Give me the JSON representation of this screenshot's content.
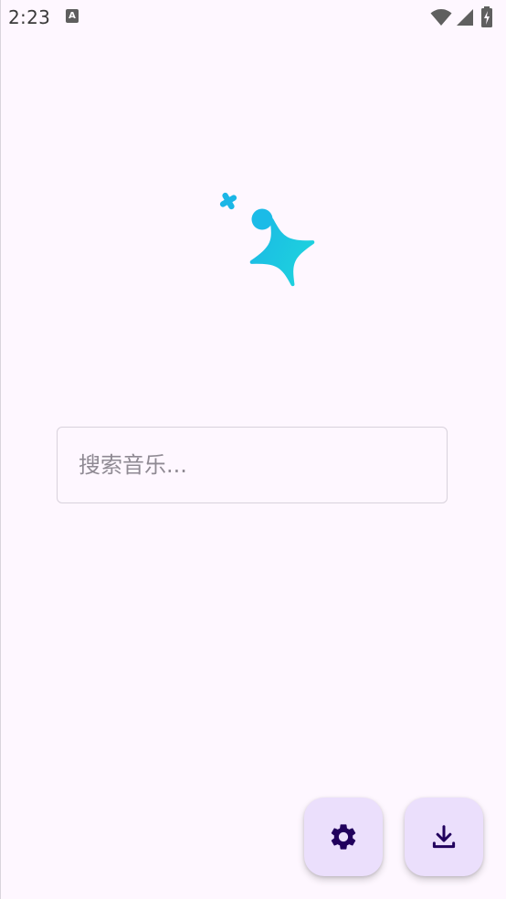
{
  "status_bar": {
    "time": "2:23",
    "app_icon_letter": "A",
    "icons": [
      "wifi-icon",
      "cellular-signal-icon",
      "battery-charging-icon"
    ]
  },
  "logo": {
    "icon": "sparkle-logo-icon",
    "colors": [
      "#1bb6e6",
      "#1ed8dc"
    ]
  },
  "search": {
    "placeholder": "搜索音乐...",
    "value": ""
  },
  "fabs": {
    "settings_icon": "gear-icon",
    "download_icon": "download-icon",
    "background": "#ebdffc",
    "icon_color": "#21005d"
  }
}
